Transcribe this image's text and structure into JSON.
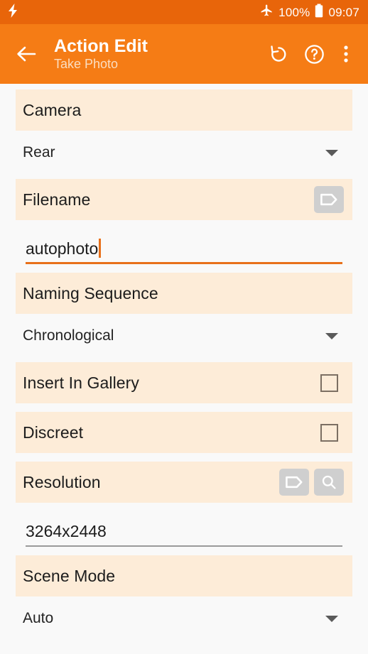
{
  "status_bar": {
    "left_icon": "lightning-bolt-icon",
    "airplane_icon": "airplane-mode-icon",
    "battery_percent": "100%",
    "battery_icon": "battery-full-icon",
    "clock": "09:07",
    "background_color": "#E8650A"
  },
  "toolbar": {
    "back_icon": "back-arrow-icon",
    "title": "Action Edit",
    "subtitle": "Take Photo",
    "actions": [
      {
        "name": "undo-icon",
        "label": "Undo"
      },
      {
        "name": "help-icon",
        "label": "Help"
      },
      {
        "name": "overflow-menu-icon",
        "label": "More options"
      }
    ],
    "background_color": "#F57C15"
  },
  "theme": {
    "accent": "#E8701A",
    "label_bar_background": "#FDECD8",
    "page_background": "#F9F9F9",
    "icon_button_background": "#CFCFCF"
  },
  "fields": {
    "camera": {
      "label": "Camera",
      "value": "Rear"
    },
    "filename": {
      "label": "Filename",
      "value": "autophoto",
      "tag_icon": "tag-icon"
    },
    "naming_sequence": {
      "label": "Naming Sequence",
      "value": "Chronological"
    },
    "insert_in_gallery": {
      "label": "Insert In Gallery",
      "checked": false
    },
    "discreet": {
      "label": "Discreet",
      "checked": false
    },
    "resolution": {
      "label": "Resolution",
      "value": "3264x2448",
      "tag_icon": "tag-icon",
      "search_icon": "search-icon"
    },
    "scene_mode": {
      "label": "Scene Mode",
      "value": "Auto"
    }
  }
}
